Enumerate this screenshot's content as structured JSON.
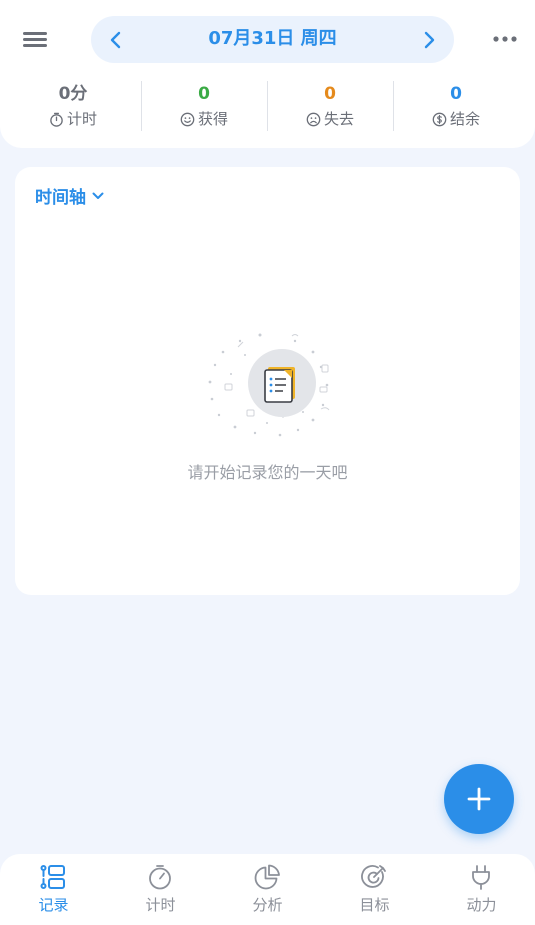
{
  "header": {
    "date": "07月31日  周四",
    "stats": [
      {
        "value": "0分",
        "label": "计时",
        "color": "#6b6f78",
        "icon": "stopwatch-icon"
      },
      {
        "value": "0",
        "label": "获得",
        "color": "#3aaa45",
        "icon": "smile-icon"
      },
      {
        "value": "0",
        "label": "失去",
        "color": "#e58a1c",
        "icon": "frown-icon"
      },
      {
        "value": "0",
        "label": "结余",
        "color": "#2b8ee8",
        "icon": "dollar-icon"
      }
    ]
  },
  "timeline": {
    "title": "时间轴",
    "empty_text": "请开始记录您的一天吧"
  },
  "colors": {
    "accent": "#2b8ee8",
    "background": "#f1f5fd",
    "inactive": "#8c9099"
  },
  "nav": [
    {
      "label": "记录",
      "icon": "record-icon",
      "active": true
    },
    {
      "label": "计时",
      "icon": "stopwatch-icon",
      "active": false
    },
    {
      "label": "分析",
      "icon": "pie-chart-icon",
      "active": false
    },
    {
      "label": "目标",
      "icon": "target-icon",
      "active": false
    },
    {
      "label": "动力",
      "icon": "plug-icon",
      "active": false
    }
  ]
}
